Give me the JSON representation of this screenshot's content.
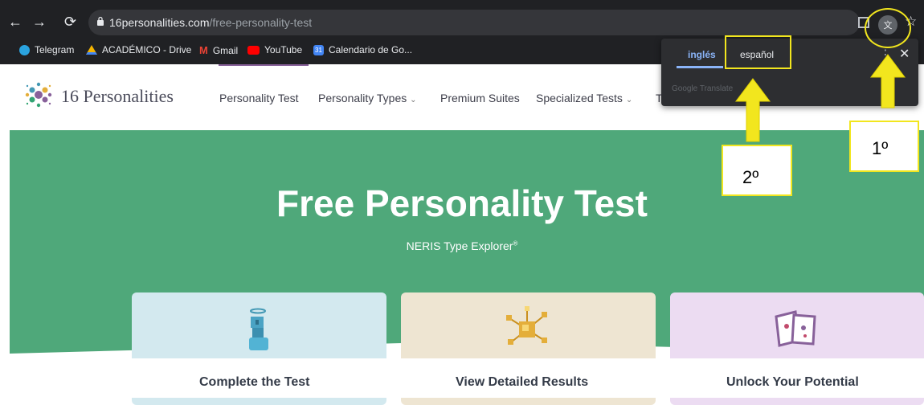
{
  "browser": {
    "url_host": "16personalities.com",
    "url_path": "/free-personality-test",
    "bookmarks": [
      {
        "label": "Telegram",
        "color": "#2aa3df"
      },
      {
        "label": "ACADÉMICO - Drive",
        "color": "#f4b400"
      },
      {
        "label": "Gmail",
        "color": "#ea4335"
      },
      {
        "label": "YouTube",
        "color": "#ff0000"
      },
      {
        "label": "Calendario de Go...",
        "color": "#4285f4"
      }
    ],
    "translate_icon": "google-translate-icon",
    "star_icon": "bookmark-star-icon"
  },
  "translate_popup": {
    "source_lang": "inglés",
    "target_lang": "español",
    "footer": "Google Translate"
  },
  "site": {
    "logo_text": "16 Personalities",
    "nav": [
      "Personality Test",
      "Personality Types",
      "Premium Suites",
      "Specialized Tests",
      "T"
    ],
    "hero_title": "Free Personality Test",
    "hero_subtitle": "NERIS Type Explorer",
    "hero_subtitle_mark": "®",
    "cards": [
      {
        "title": "Complete the Test",
        "color": "#d3e9ef"
      },
      {
        "title": "View Detailed Results",
        "color": "#eee5d2"
      },
      {
        "title": "Unlock Your Potential",
        "color": "#ecdcf2"
      }
    ]
  },
  "annotations": {
    "step1": "1º",
    "step2": "2º",
    "color": "#f2e61e"
  }
}
